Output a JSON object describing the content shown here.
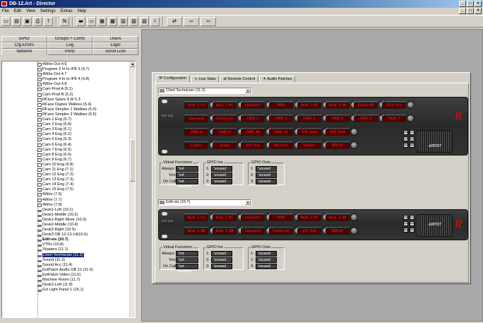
{
  "window": {
    "title": "DB-12.Art - Director",
    "min": "_",
    "max": "□",
    "close": "×"
  },
  "menu": [
    "File",
    "Edit",
    "View",
    "Settings",
    "Extras",
    "Help"
  ],
  "mdi": {
    "min": "_",
    "max": "□",
    "close": "×"
  },
  "toolbar": [
    {
      "name": "new-icon",
      "glyph": "▭"
    },
    {
      "name": "open-icon",
      "glyph": "▤"
    },
    {
      "name": "save-icon",
      "glyph": "▣"
    },
    {
      "name": "print-icon",
      "glyph": "⎙"
    },
    {
      "name": "help-icon",
      "glyph": "?"
    },
    {
      "name": "net-icon",
      "glyph": "N"
    },
    {
      "name": "view1-icon",
      "glyph": "▬"
    },
    {
      "name": "view2-icon",
      "glyph": "▭"
    },
    {
      "name": "view3-icon",
      "glyph": "▦"
    },
    {
      "name": "view4-icon",
      "glyph": "▩"
    },
    {
      "name": "view5-icon",
      "glyph": "▥"
    },
    {
      "name": "view6-icon",
      "glyph": "▧"
    },
    {
      "name": "view7-icon",
      "glyph": "▨"
    },
    {
      "name": "info-icon",
      "glyph": "i"
    }
  ],
  "toolbar2": [
    {
      "name": "route-icon",
      "glyph": "⇄"
    },
    {
      "name": "panel-send-icon",
      "glyph": "⇨"
    },
    {
      "name": "panel-recv-icon",
      "glyph": "⇦"
    }
  ],
  "left_tabs": {
    "row1": [
      "GPIO",
      "Groups + Confs",
      "Users"
    ],
    "row2": [
      "Cfg Errors",
      "Log",
      "Logic"
    ],
    "row3": [
      "Network",
      "Ports",
      "Scroll Lists"
    ]
  },
  "tree": [
    {
      "label": "4Wire Out 4.6",
      "icon": "port"
    },
    {
      "label": "Program 3 In to IFB 3 (4.7)",
      "icon": "port"
    },
    {
      "label": "4Wire Out 4.7",
      "icon": "port"
    },
    {
      "label": "Program 4 In to IFB 4 (4.8)",
      "icon": "port"
    },
    {
      "label": "4Wire Out 4.8",
      "icon": "port"
    },
    {
      "label": "Cam Prod A (5.1)",
      "icon": "port"
    },
    {
      "label": "Cam Prod B (5.2)",
      "icon": "port"
    },
    {
      "label": "RFace Spare 4 W 5.3",
      "icon": "port"
    },
    {
      "label": "RFace Duplex Walkies (5.4)",
      "icon": "port"
    },
    {
      "label": "RFace Simplex 1 Walkies (5.5)",
      "icon": "port"
    },
    {
      "label": "RFace Simplex 2 Walkies (5.6)",
      "icon": "port"
    },
    {
      "label": "Cam 1 Eng (5.7)",
      "icon": "port"
    },
    {
      "label": "Cam 2 Eng (5.8)",
      "icon": "port"
    },
    {
      "label": "Cam 3 Eng (6.1)",
      "icon": "port"
    },
    {
      "label": "Cam 4 Eng (6.2)",
      "icon": "port"
    },
    {
      "label": "Cam 5 Eng (6.3)",
      "icon": "port"
    },
    {
      "label": "Cam 6 Eng (6.4)",
      "icon": "port"
    },
    {
      "label": "Cam 7 Eng (6.5)",
      "icon": "port"
    },
    {
      "label": "Cam 8 Eng (6.6)",
      "icon": "port"
    },
    {
      "label": "Cam 9 Eng (6.7)",
      "icon": "port"
    },
    {
      "label": "Cam 10 Eng (6.8)",
      "icon": "port"
    },
    {
      "label": "Cam 11 Eng (7.1)",
      "icon": "port"
    },
    {
      "label": "Cam 12 Eng (7.2)",
      "icon": "port"
    },
    {
      "label": "Cam 13 Eng (7.3)",
      "icon": "port"
    },
    {
      "label": "Cam 14 Eng (7.4)",
      "icon": "port"
    },
    {
      "label": "Cam 15 Eng (7.5)",
      "icon": "port"
    },
    {
      "label": "4Wire (7.6)",
      "icon": "port"
    },
    {
      "label": "4Wire (7.7)",
      "icon": "port"
    },
    {
      "label": "4Wire (7.8)",
      "icon": "port"
    },
    {
      "label": "Desk1-Left (10.1)",
      "icon": "panel"
    },
    {
      "label": "Desk1-Middle (10.2)",
      "icon": "panel"
    },
    {
      "label": "Desk1-Right Mixer (10.3)",
      "icon": "panel"
    },
    {
      "label": "Desk2-Middle (10.4)",
      "icon": "panel"
    },
    {
      "label": "Desk2-Right (10.5)",
      "icon": "panel"
    },
    {
      "label": "Desk3 OB 12-13-14(10.6)",
      "icon": "panel"
    },
    {
      "label": "Edit-vts (10.7)",
      "icon": "panel",
      "bold": true
    },
    {
      "label": "VTRs (10.8)",
      "icon": "panel"
    },
    {
      "label": "Shaders (11.1)",
      "icon": "panel"
    },
    {
      "label": "Chief Technician (11.2)",
      "icon": "panel",
      "selected": true
    },
    {
      "label": "Sound (11.3)",
      "icon": "panel"
    },
    {
      "label": "Sound Acc (11.4)",
      "icon": "panel"
    },
    {
      "label": "ExtPatch-Audio OB 12 (11.5)",
      "icon": "panel"
    },
    {
      "label": "ExtPatch-Video (11.6)",
      "icon": "panel"
    },
    {
      "label": "Machine Room (11.7)",
      "icon": "panel"
    },
    {
      "label": "Desk2-Left (11.8)",
      "icon": "panel"
    },
    {
      "label": "Ext Light Panel 1 (15.1)",
      "icon": "panel"
    }
  ],
  "dialog": {
    "tabs": [
      "Configuration",
      "Live Stats",
      "Remote Control",
      "Audio Patches"
    ],
    "panel1": {
      "combo": "Chief Technician (11.2)",
      "model": "RCP 1036",
      "rows": [
        [
          "Desk 1-Lt",
          "Desk 1-Mi",
          "Ldesk2Lt",
          "PGM2",
          "Desk 2-Rt",
          "Desk 3-Ob",
          "Desk3-OB",
          "Edit-vts"
        ],
        [
          "Camsound",
          "Technical",
          "FOUR_2",
          "FOUR_3",
          "FOUR_4",
          "FOUR_5",
          "FOUR_6",
          "FOUR_7"
        ],
        [
          "FOUR_8",
          "FOUR_9",
          "FOUR_10",
          "FOUR_11",
          "IFB Send",
          "IFB Send"
        ],
        [
          "Lights",
          "Sound",
          "Chf Eng",
          "Machine",
          "Shader",
          "REPLAY"
        ]
      ],
      "side_buttons": [
        "SHIFT",
        "VOL",
        "LIST",
        "DISP",
        "MENU",
        "RPLY"
      ],
      "brand": "ARTIST",
      "logo": "R"
    },
    "panel2": {
      "combo": "Edit-vts (10.7)",
      "model": "RCP 1016",
      "rows": [
        [
          "Desk 1-Lt",
          "Desk 1-Mi",
          "Ldesk2Lt",
          "PGM2",
          "Desk 2-Rt",
          "Desk 3-Ob"
        ],
        [
          "Desk 3 OB",
          "Desk 3 OB",
          "Camsound",
          "Technical",
          "Chf Eng",
          "REPLAY"
        ]
      ],
      "side_buttons": [
        "SHIFT",
        "VOL",
        "LIST",
        "DISP",
        "MENU",
        "RPLY"
      ],
      "brand": "ARTIST",
      "logo": "R"
    },
    "vf": {
      "title": "Virtual Functions",
      "labels": [
        "Always:",
        "Vox:",
        "On Call:"
      ],
      "value": "not assigned"
    },
    "gpio_in": {
      "title": "GPIO Ins",
      "labels": [
        "1:",
        "2:",
        "3:"
      ],
      "value": "unused"
    },
    "gpio_out": {
      "title": "GPIO Outs",
      "labels": [
        "1:",
        "2:",
        "3:"
      ],
      "value": "unused"
    }
  }
}
